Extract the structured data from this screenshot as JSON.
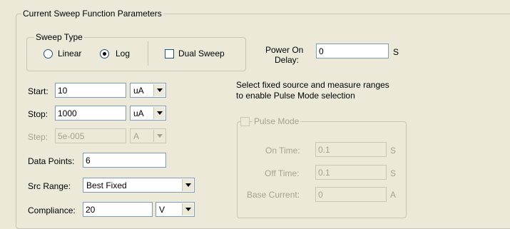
{
  "group_title": "Current Sweep Function Parameters",
  "sweep_type": {
    "title": "Sweep Type",
    "linear_label": "Linear",
    "log_label": "Log",
    "selected": "Log",
    "dual_sweep_label": "Dual Sweep",
    "dual_sweep_checked": false
  },
  "power_on_delay": {
    "label_line1": "Power On",
    "label_line2": "Delay:",
    "value": "0",
    "unit": "S"
  },
  "pulse_hint": {
    "line1": "Select fixed source and measure ranges",
    "line2": "to enable Pulse Mode selection"
  },
  "start": {
    "label": "Start:",
    "value": "10",
    "unit": "uA"
  },
  "stop": {
    "label": "Stop:",
    "value": "1000",
    "unit": "uA"
  },
  "step": {
    "label": "Step:",
    "value": "5e-005",
    "unit": "A"
  },
  "data_points": {
    "label": "Data Points:",
    "value": "6"
  },
  "src_range": {
    "label": "Src Range:",
    "value": "Best Fixed"
  },
  "compliance": {
    "label": "Compliance:",
    "value": "20",
    "unit": "V"
  },
  "pulse_mode": {
    "label": "Pulse Mode",
    "checked": false,
    "on_time": {
      "label": "On Time:",
      "value": "0.1",
      "unit": "S"
    },
    "off_time": {
      "label": "Off Time:",
      "value": "0.1",
      "unit": "S"
    },
    "base_current": {
      "label": "Base Current:",
      "value": "0",
      "unit": "A"
    }
  }
}
